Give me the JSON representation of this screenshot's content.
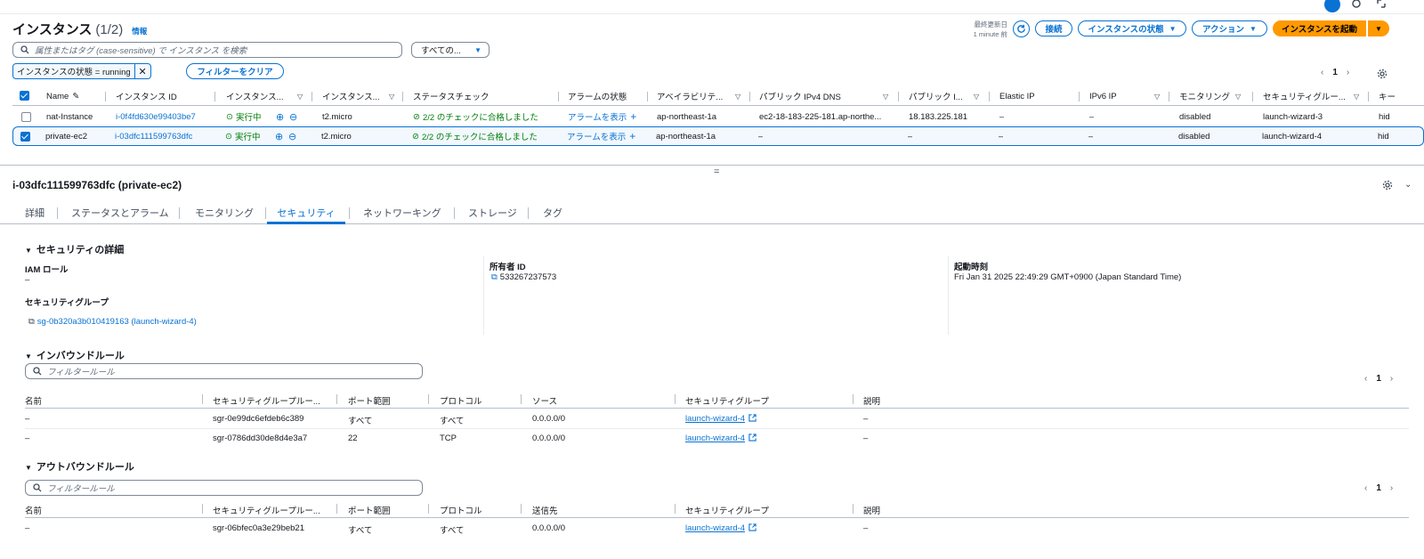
{
  "header": {
    "title": "インスタンス",
    "count": "(1/2)",
    "info": "情報",
    "last_updated_label": "最終更新日",
    "last_updated_value": "1 minute 前",
    "connect_button": "接続",
    "state_button": "インスタンスの状態",
    "actions_button": "アクション",
    "launch_button": "インスタンスを起動"
  },
  "search": {
    "placeholder": "属性またはタグ (case-sensitive) で インスタンス を検索",
    "filter_select": "すべての..."
  },
  "filter": {
    "token": "インスタンスの状態 = running",
    "clear_button": "フィルターをクリア"
  },
  "pagination": {
    "page": "1"
  },
  "table": {
    "headers": [
      "Name",
      "インスタンス ID",
      "インスタンス...",
      "インスタンス...",
      "ステータスチェック",
      "アラームの状態",
      "アベイラビリテ...",
      "パブリック IPv4 DNS",
      "パブリック I...",
      "Elastic IP",
      "IPv6 IP",
      "モニタリング",
      "セキュリティグルー...",
      "キー"
    ],
    "rows": [
      {
        "selected": false,
        "name": "nat-Instance",
        "id": "i-0f4fd630e99403be7",
        "state": "実行中",
        "type": "t2.micro",
        "check": "2/2 のチェックに合格しました",
        "alarm": "アラームを表示",
        "az": "ap-northeast-1a",
        "dns": "ec2-18-183-225-181.ap-northe...",
        "ip": "18.183.225.181",
        "eip": "–",
        "ipv6": "–",
        "monitoring": "disabled",
        "sg": "launch-wizard-3",
        "key": "hid"
      },
      {
        "selected": true,
        "name": "private-ec2",
        "id": "i-03dfc111599763dfc",
        "state": "実行中",
        "type": "t2.micro",
        "check": "2/2 のチェックに合格しました",
        "alarm": "アラームを表示",
        "az": "ap-northeast-1a",
        "dns": "–",
        "ip": "–",
        "eip": "–",
        "ipv6": "–",
        "monitoring": "disabled",
        "sg": "launch-wizard-4",
        "key": "hid"
      }
    ]
  },
  "detail": {
    "title": "i-03dfc111599763dfc (private-ec2)",
    "tabs": [
      "詳細",
      "ステータスとアラーム",
      "モニタリング",
      "セキュリティ",
      "ネットワーキング",
      "ストレージ",
      "タグ"
    ],
    "active_tab": "セキュリティ",
    "security_details_title": "セキュリティの詳細",
    "iam_role_label": "IAM ロール",
    "iam_role_value": "–",
    "owner_label": "所有者 ID",
    "owner_value": "533267237573",
    "launch_label": "起動時刻",
    "launch_value": "Fri Jan 31 2025 22:49:29 GMT+0900 (Japan Standard Time)",
    "sg_label": "セキュリティグループ",
    "sg_value": "sg-0b320a3b010419163 (launch-wizard-4)"
  },
  "inbound": {
    "title": "インバウンドルール",
    "placeholder": "フィルタールール",
    "page": "1",
    "headers": [
      "名前",
      "セキュリティグループルー...",
      "ポート範囲",
      "プロトコル",
      "ソース",
      "セキュリティグループ",
      "説明"
    ],
    "rows": [
      [
        "–",
        "sgr-0e99dc6efdeb6c389",
        "すべて",
        "すべて",
        "0.0.0.0/0",
        "launch-wizard-4",
        "–"
      ],
      [
        "–",
        "sgr-0786dd30de8d4e3a7",
        "22",
        "TCP",
        "0.0.0.0/0",
        "launch-wizard-4",
        "–"
      ]
    ]
  },
  "outbound": {
    "title": "アウトバウンドルール",
    "placeholder": "フィルタールール",
    "page": "1",
    "headers": [
      "名前",
      "セキュリティグループルー...",
      "ポート範囲",
      "プロトコル",
      "送信先",
      "セキュリティグループ",
      "説明"
    ],
    "rows": [
      [
        "–",
        "sgr-06bfec0a3e29beb21",
        "すべて",
        "すべて",
        "0.0.0.0/0",
        "launch-wizard-4",
        "–"
      ]
    ]
  },
  "colors": {
    "link": "#0972d3",
    "primary": "#ff9900",
    "success": "#037f0c"
  }
}
